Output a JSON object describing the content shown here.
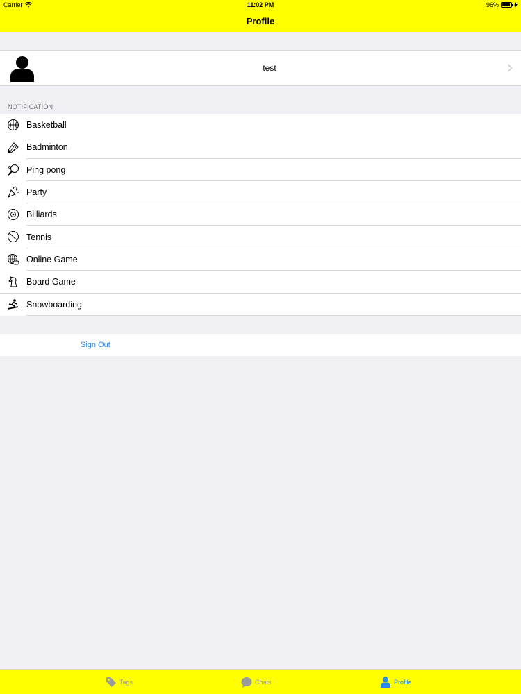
{
  "status_bar": {
    "carrier": "Carrier",
    "time": "11:02 PM",
    "battery": "96%"
  },
  "nav": {
    "title": "Profile"
  },
  "profile": {
    "username": "test"
  },
  "notification": {
    "header": "NOTIFICATION",
    "items": [
      {
        "label": "Basketball",
        "icon": "basketball-icon"
      },
      {
        "label": "Badminton",
        "icon": "shuttlecock-icon"
      },
      {
        "label": "Ping pong",
        "icon": "ping-pong-icon"
      },
      {
        "label": "Party",
        "icon": "party-popper-icon"
      },
      {
        "label": "Billiards",
        "icon": "billiard-ball-icon"
      },
      {
        "label": "Tennis",
        "icon": "tennis-ball-icon"
      },
      {
        "label": "Online Game",
        "icon": "globe-controller-icon"
      },
      {
        "label": "Board Game",
        "icon": "chess-piece-icon"
      },
      {
        "label": "Snowboarding",
        "icon": "snowboarder-icon"
      }
    ]
  },
  "actions": {
    "sign_out": "Sign Out"
  },
  "tabs": [
    {
      "label": "Tags",
      "icon": "tag-icon",
      "active": false
    },
    {
      "label": "Chats",
      "icon": "chat-bubble-icon",
      "active": false
    },
    {
      "label": "Profile",
      "icon": "person-icon",
      "active": true
    }
  ],
  "colors": {
    "accent": "#2a8ae6",
    "bar_background": "#ffff00",
    "page_background": "#efeff4",
    "inactive_tab": "#9a9a9a"
  }
}
